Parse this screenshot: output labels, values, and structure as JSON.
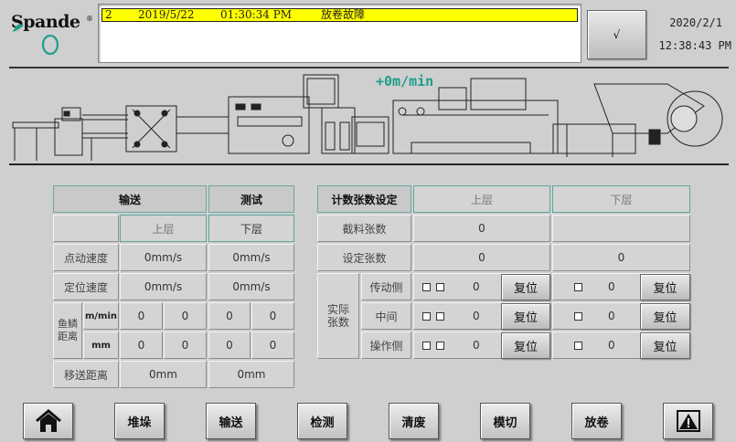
{
  "brand": {
    "name": "Spande",
    "reg": "®"
  },
  "alarm": {
    "index": "2",
    "date": "2019/5/22",
    "time": "01:30:34 PM",
    "message": "放卷故障"
  },
  "ack_button": "√",
  "clock": {
    "date": "2020/2/1",
    "time": "12:38:43 PM"
  },
  "speed_display": "+0m/min",
  "left_table": {
    "tab_convey": "输送",
    "tab_test": "测试",
    "col_upper": "上层",
    "col_lower": "下层",
    "rows": [
      {
        "label": "点动速度",
        "upper": "0mm/s",
        "lower": "0mm/s"
      },
      {
        "label": "定位速度",
        "upper": "0mm/s",
        "lower": "0mm/s"
      }
    ],
    "fish_label": "鱼鳞距离",
    "fish_rows": [
      {
        "unit": "m/min",
        "values": [
          "0",
          "0",
          "0",
          "0"
        ]
      },
      {
        "unit": "mm",
        "values": [
          "0",
          "0",
          "0",
          "0"
        ]
      }
    ],
    "move_label": "移送距离",
    "move_upper": "0mm",
    "move_lower": "0mm"
  },
  "right_table": {
    "title": "计数张数设定",
    "col_upper": "上层",
    "col_lower": "下层",
    "cut_label": "截料张数",
    "cut_upper": "0",
    "cut_lower": "",
    "set_label": "设定张数",
    "set_upper": "0",
    "set_lower": "0",
    "actual_label": "实际张数",
    "reset_label": "复位",
    "rows": [
      {
        "side": "传动侧",
        "upper": "0",
        "lower": "0"
      },
      {
        "side": "中间",
        "upper": "0",
        "lower": "0"
      },
      {
        "side": "操作侧",
        "upper": "0",
        "lower": "0"
      }
    ]
  },
  "nav": {
    "home": "home-icon",
    "items": [
      "堆垛",
      "输送",
      "检测",
      "清废",
      "模切",
      "放卷"
    ],
    "alarm": "warning-icon"
  }
}
